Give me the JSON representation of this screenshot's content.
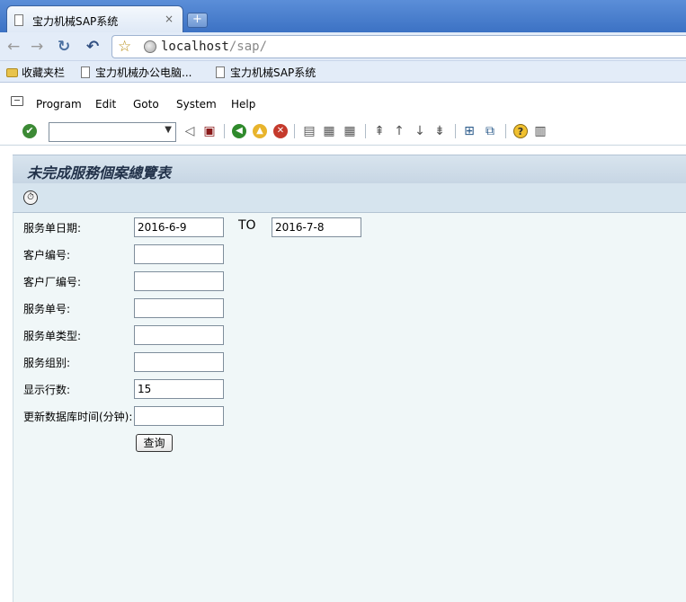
{
  "browser": {
    "tab_title": "宝力机械SAP系统",
    "tab_close": "×",
    "new_tab": "+",
    "url_host": "localhost",
    "url_path": "/sap/",
    "nav": {
      "back": "←",
      "forward": "→",
      "reload": "↻",
      "undo": "↶",
      "star": "☆"
    },
    "bookmarks": [
      {
        "label": "收藏夹栏",
        "icon": "folder-icon"
      },
      {
        "label": "宝力机械办公电脑...",
        "icon": "page-icon"
      },
      {
        "label": "宝力机械SAP系统",
        "icon": "page-icon"
      }
    ]
  },
  "sap": {
    "menu": [
      "Program",
      "Edit",
      "Goto",
      "System",
      "Help"
    ],
    "toolbar_icons": [
      "enter-check-icon",
      "command-field",
      "back-arrow-icon",
      "save-icon",
      "back-icon",
      "exit-icon",
      "cancel-icon",
      "print-icon",
      "find-icon",
      "find-next-icon",
      "first-page-icon",
      "previous-page-icon",
      "next-page-icon",
      "last-page-icon",
      "create-session-icon",
      "shortcut-icon",
      "help-icon",
      "layout-icon"
    ],
    "screen_title": "未完成服務個案總覽表",
    "execute_icon": "execute-icon",
    "form": {
      "date_label": "服务单日期:",
      "date_from": "2016-6-9",
      "to_label": "TO",
      "date_to": "2016-7-8",
      "customer_no_label": "客户编号:",
      "customer_no": "",
      "customer_factory_label": "客户厂编号:",
      "customer_factory": "",
      "service_no_label": "服务单号:",
      "service_no": "",
      "service_type_label": "服务单类型:",
      "service_type": "",
      "service_group_label": "服务组别:",
      "service_group": "",
      "rows_label": "显示行数:",
      "rows_value": "15",
      "refresh_label": "更新数据库时间(分钟):",
      "refresh_value": "",
      "query_button": "查询"
    }
  }
}
